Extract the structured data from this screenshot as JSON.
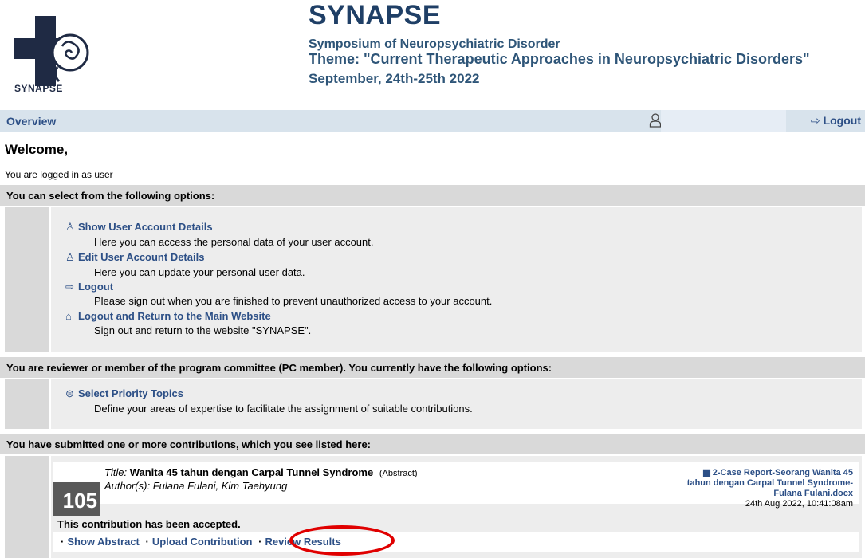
{
  "header": {
    "logo_text": "SYNAPSE",
    "title": "SYNAPSE",
    "subtitle1": "Symposium of Neuropsychiatric Disorder",
    "subtitle2": "Theme: \"Current Therapeutic Approaches in Neuropsychiatric Disorders\"",
    "subtitle3": "September, 24th-25th 2022"
  },
  "nav": {
    "overview": "Overview",
    "logout": "Logout"
  },
  "welcome": "Welcome,",
  "logged_in": "You are logged in as user",
  "sections": {
    "options_head": "You can select from the following options:",
    "options": [
      {
        "label": "Show User Account Details",
        "desc": "Here you can access the personal data of your user account."
      },
      {
        "label": "Edit User Account Details",
        "desc": "Here you can update your personal user data."
      },
      {
        "label": "Logout",
        "desc": "Please sign out when you are finished to prevent unauthorized access to your account."
      },
      {
        "label": "Logout and Return to the Main Website",
        "desc": "Sign out and return to the website \"SYNAPSE\"."
      }
    ],
    "reviewer_head": "You are reviewer or member of the program committee (PC member). You currently have the following options:",
    "reviewer_option": {
      "label": "Select Priority Topics",
      "desc": "Define your areas of expertise to facilitate the assignment of suitable contributions."
    },
    "contrib_head": "You have submitted one or more contributions, which you see listed here:"
  },
  "contribution": {
    "number": "105",
    "title_label": "Title:",
    "title": "Wanita 45 tahun dengan Carpal Tunnel Syndrome",
    "type": "(Abstract)",
    "authors_label": "Author(s):",
    "authors": "Fulana Fulani, Kim Taehyung",
    "file_line1": "2-Case Report-Seorang Wanita 45",
    "file_line2": "tahun dengan Carpal Tunnel Syndrome-",
    "file_line3": "Fulana Fulani.docx",
    "file_date": "24th Aug 2022, 10:41:08am",
    "status": "This contribution has been accepted.",
    "actions": [
      "Show Abstract",
      "Upload Contribution",
      "Review Results"
    ]
  },
  "colors": {
    "link": "#2c4f86",
    "navbar": "#d8e3ec",
    "section": "#d9d9d9",
    "highlight": "#e00000"
  }
}
